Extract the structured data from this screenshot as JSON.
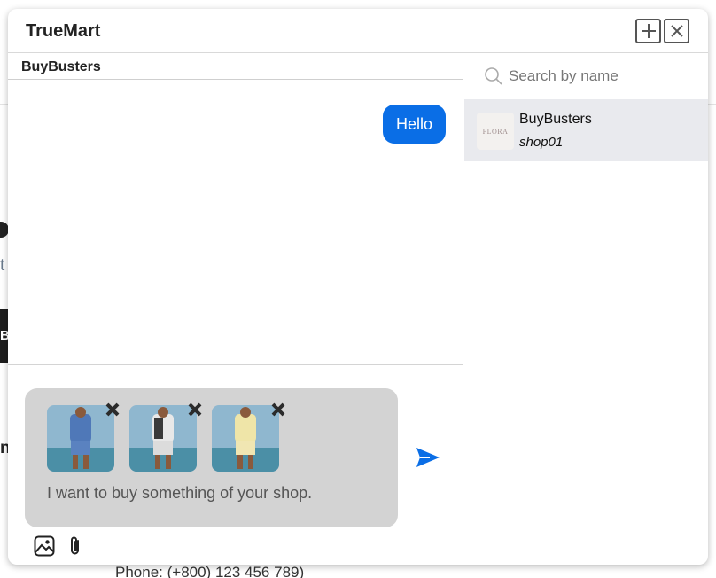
{
  "app": {
    "title": "TrueMart"
  },
  "conversation": {
    "title": "BuyBusters",
    "messages": [
      {
        "text": "Hello",
        "sender": "me"
      }
    ]
  },
  "composer": {
    "text": "I want to buy something of your shop.",
    "attachments": [
      {
        "name": "blue-outfit",
        "color": "#4f78b8"
      },
      {
        "name": "patterned-outfit",
        "color": "#e8e8e8"
      },
      {
        "name": "yellow-outfit",
        "color": "#efe5a8"
      }
    ]
  },
  "search": {
    "placeholder": "Search by name"
  },
  "contacts": [
    {
      "name": "BuyBusters",
      "subtitle": "shop01",
      "avatar_text": "FLORA"
    }
  ],
  "background": {
    "phone": "Phone: (+800) 123 456 789)"
  },
  "colors": {
    "accent": "#0a6ee6",
    "composer_bg": "#d3d3d3",
    "selected_contact": "#e9eaee"
  }
}
